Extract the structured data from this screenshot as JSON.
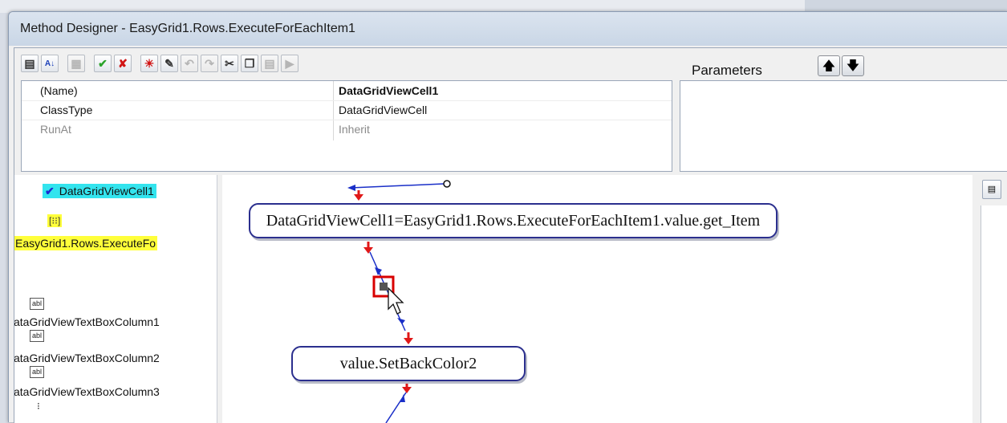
{
  "window": {
    "title": "Method Designer - EasyGrid1.Rows.ExecuteForEachItem1"
  },
  "toolbar": {
    "buttons": [
      {
        "name": "categorized-view-button",
        "icon": "categorized-icon",
        "glyph": "▤"
      },
      {
        "name": "sort-alpha-button",
        "icon": "sort-az-icon",
        "glyph": "A↓"
      },
      {
        "name": "property-pages-button",
        "icon": "property-pages-icon",
        "glyph": "▦",
        "disabled": true
      },
      {
        "name": "ok-button",
        "icon": "check-icon",
        "glyph": "✔"
      },
      {
        "name": "cancel-button",
        "icon": "x-icon",
        "glyph": "✘"
      },
      {
        "name": "debug-button",
        "icon": "sun-icon",
        "glyph": "☀"
      },
      {
        "name": "magic-wand-button",
        "icon": "wand-icon",
        "glyph": "✎"
      },
      {
        "name": "undo-button",
        "icon": "undo-icon",
        "glyph": "↶",
        "disabled": true
      },
      {
        "name": "redo-button",
        "icon": "redo-icon",
        "glyph": "↷",
        "disabled": true
      },
      {
        "name": "cut-button",
        "icon": "scissors-icon",
        "glyph": "✂"
      },
      {
        "name": "copy-button",
        "icon": "copy-icon",
        "glyph": "❐"
      },
      {
        "name": "paste-button",
        "icon": "paste-icon",
        "glyph": "▤",
        "disabled": true
      },
      {
        "name": "run-button",
        "icon": "play-icon",
        "glyph": "▶",
        "disabled": true
      }
    ]
  },
  "properties": [
    {
      "name": "(Name)",
      "value": "DataGridViewCell1",
      "bold": true
    },
    {
      "name": "ClassType",
      "value": "DataGridViewCell"
    },
    {
      "name": "RunAt",
      "value": "Inherit",
      "dim": true
    }
  ],
  "parameters": {
    "label": "Parameters",
    "up_icon": "move-up-icon",
    "down_icon": "move-down-icon",
    "up_glyph": "🡅",
    "down_glyph": "🡇"
  },
  "left_panel": {
    "item1": "DataGridViewCell1",
    "item2": "EasyGrid1.Rows.ExecuteFo",
    "abl": "abl",
    "col1": "ataGridViewTextBoxColumn1",
    "col2": "ataGridViewTextBoxColumn2",
    "col3": "ataGridViewTextBoxColumn3"
  },
  "canvas": {
    "node1": "DataGridViewCell1=EasyGrid1.Rows.ExecuteForEachItem1.value.get_Item",
    "node2": "value.SetBackColor2"
  },
  "colors": {
    "connector": "#1a2fc8",
    "arrow": "#e01818",
    "node_border": "#2b2f8e",
    "selection": "#d80000"
  }
}
